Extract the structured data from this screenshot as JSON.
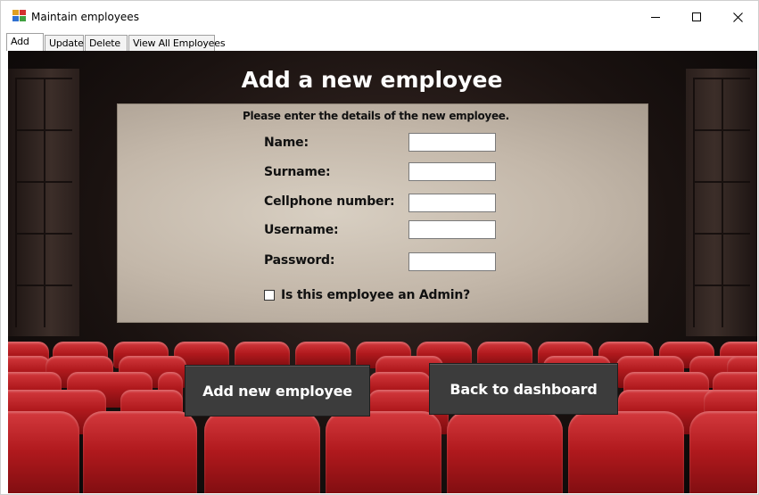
{
  "window": {
    "title": "Maintain employees"
  },
  "tabs": [
    {
      "label": "Add",
      "active": true
    },
    {
      "label": "Update",
      "active": false
    },
    {
      "label": "Delete",
      "active": false
    },
    {
      "label": "View All Employees",
      "active": false
    }
  ],
  "form": {
    "heading": "Add a new employee",
    "instructions": "Please enter the details of the new employee.",
    "fields": [
      {
        "label": "Name:",
        "value": ""
      },
      {
        "label": "Surname:",
        "value": ""
      },
      {
        "label": "Cellphone number:",
        "value": ""
      },
      {
        "label": "Username:",
        "value": ""
      },
      {
        "label": "Password:",
        "value": ""
      }
    ],
    "admin_checkbox": {
      "label": "Is this employee an Admin?",
      "checked": false
    }
  },
  "buttons": {
    "add_label": "Add new employee",
    "back_label": "Back to dashboard"
  },
  "colors": {
    "button_bg": "#3c3c3c",
    "seat_red": "#b0191d",
    "screen": "#c3b7a9"
  },
  "icons": {
    "app": "app-window-icon",
    "minimize": "minimize-icon",
    "maximize": "maximize-icon",
    "close": "close-icon"
  }
}
